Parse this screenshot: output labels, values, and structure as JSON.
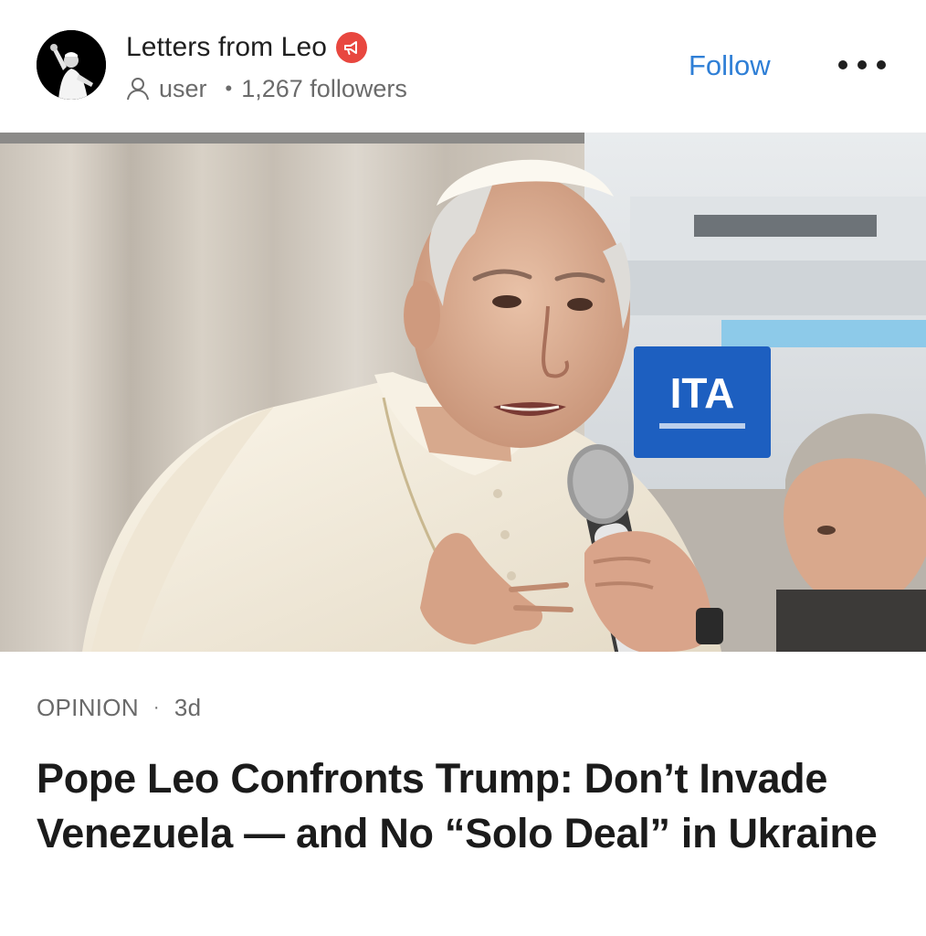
{
  "publication": {
    "name": "Letters from Leo",
    "author_label": "user",
    "followers": "1,267 followers",
    "follow_label": "Follow"
  },
  "icons": {
    "avatar": "pope-waving-avatar",
    "badge": "megaphone-icon",
    "author": "user-icon",
    "more": "more-horizontal-icon"
  },
  "colors": {
    "follow": "#2f7fd6",
    "badge": "#e8473f"
  },
  "article": {
    "category": "OPINION",
    "age": "3d",
    "headline": "Pope Leo Confronts Trump: Don’t Invade Venezuela — and No “Solo Deal” in Ukraine"
  },
  "hero": {
    "sign_text": "ITA"
  }
}
